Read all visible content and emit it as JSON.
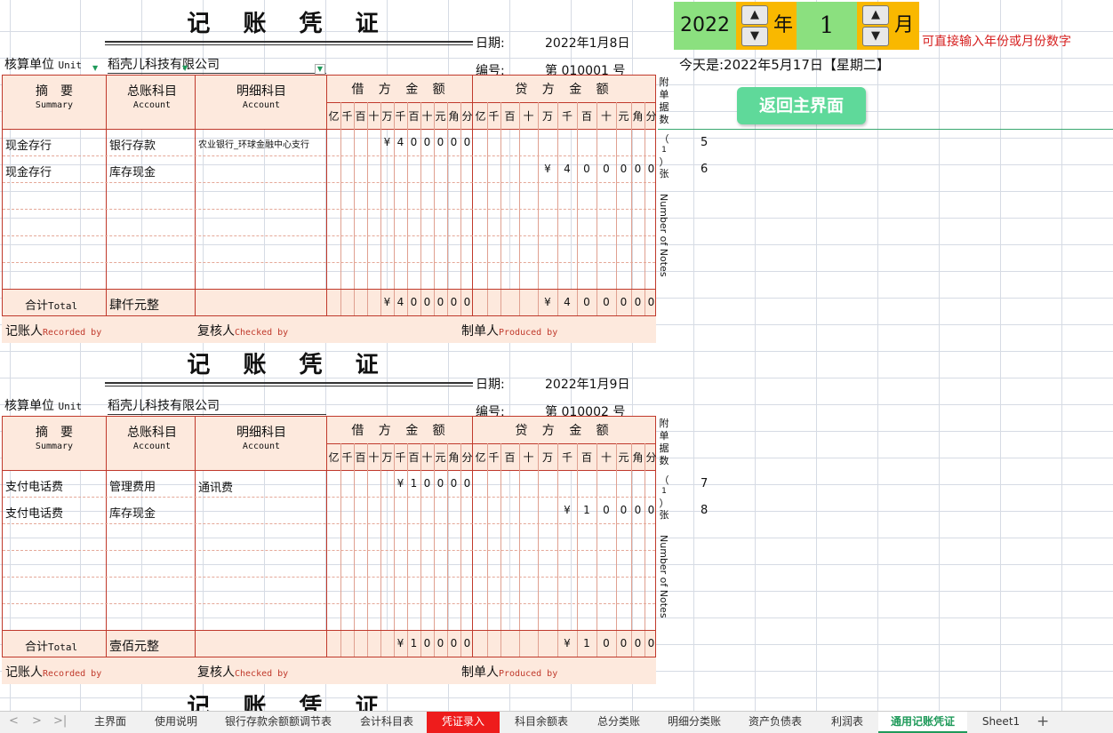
{
  "labels": {
    "title": "记 账 凭 证",
    "date": "日期:",
    "number": "编号:",
    "unit": "核算单位",
    "unit_en": "Unit",
    "summary": "摘　要",
    "summary_en": "Summary",
    "account": "总账科目",
    "account_en": "Account",
    "detail": "明细科目",
    "detail_en": "Account",
    "debit": "借 方 金 额",
    "credit": "贷 方 金 额",
    "digits_debit": [
      "亿",
      "千",
      "百",
      "十",
      "万",
      "千",
      "百",
      "十",
      "元",
      "角",
      "分"
    ],
    "digits_credit": [
      "亿",
      "千",
      "百",
      "十",
      "万",
      "千",
      "百",
      "十",
      "元",
      "角",
      "分"
    ],
    "total": "合计",
    "total_en": "Total",
    "recorder": "记账人",
    "recorder_en": "Recorded by",
    "checker": "复核人",
    "checker_en": "Checked by",
    "producer": "制单人",
    "producer_en": "Produced by",
    "attach_chars": [
      "附",
      "单",
      "据",
      "数"
    ],
    "attach_paren": [
      "（",
      "1",
      "）",
      "张"
    ],
    "notes_en": "Number of Notes"
  },
  "vouchers": [
    {
      "date": "2022年1月8日",
      "number": "第 010001 号",
      "unit_name": "稻壳儿科技有限公司",
      "rows": [
        {
          "summary": "现金存行",
          "account": "银行存款",
          "detail": "农业银行_环球金融中心支行",
          "debit": [
            "",
            "",
            "",
            "",
            "¥",
            "4",
            "0",
            "0",
            "0",
            "0",
            "0"
          ],
          "credit": [
            "",
            "",
            "",
            "",
            "",
            "",
            "",
            "",
            "",
            "",
            ""
          ]
        },
        {
          "summary": "现金存行",
          "account": "库存现金",
          "detail": "",
          "debit": [
            "",
            "",
            "",
            "",
            "",
            "",
            "",
            "",
            "",
            "",
            ""
          ],
          "credit": [
            "",
            "",
            "",
            "",
            "¥",
            "4",
            "0",
            "0",
            "0",
            "0",
            "0"
          ]
        }
      ],
      "total_text": "肆仟元整",
      "total_debit": [
        "",
        "",
        "",
        "",
        "¥",
        "4",
        "0",
        "0",
        "0",
        "0",
        "0"
      ],
      "total_credit": [
        "",
        "",
        "",
        "",
        "¥",
        "4",
        "0",
        "0",
        "0",
        "0",
        "0"
      ],
      "side_numbers": [
        "5",
        "6"
      ]
    },
    {
      "date": "2022年1月9日",
      "number": "第 010002 号",
      "unit_name": "稻壳儿科技有限公司",
      "rows": [
        {
          "summary": "支付电话费",
          "account": "管理费用",
          "detail": "通讯费",
          "debit": [
            "",
            "",
            "",
            "",
            "",
            "¥",
            "1",
            "0",
            "0",
            "0",
            "0"
          ],
          "credit": [
            "",
            "",
            "",
            "",
            "",
            "",
            "",
            "",
            "",
            "",
            ""
          ]
        },
        {
          "summary": "支付电话费",
          "account": "库存现金",
          "detail": "",
          "debit": [
            "",
            "",
            "",
            "",
            "",
            "",
            "",
            "",
            "",
            "",
            ""
          ],
          "credit": [
            "",
            "",
            "",
            "",
            "",
            "¥",
            "1",
            "0",
            "0",
            "0",
            "0"
          ]
        }
      ],
      "total_text": "壹佰元整",
      "total_debit": [
        "",
        "",
        "",
        "",
        "",
        "¥",
        "1",
        "0",
        "0",
        "0",
        "0"
      ],
      "total_credit": [
        "",
        "",
        "",
        "",
        "",
        "¥",
        "1",
        "0",
        "0",
        "0",
        "0"
      ],
      "side_numbers": [
        "7",
        "8"
      ]
    }
  ],
  "third_title_partial": "记 账 凭 证",
  "controls": {
    "year": "2022",
    "year_suffix": "年",
    "month": "1",
    "month_suffix": "月",
    "spin_up": "▲",
    "spin_down": "▼",
    "hint": "可直接输入年份或月份数字",
    "today": "今天是:2022年5月17日【星期二】",
    "back_button": "返回主界面"
  },
  "sheet_tabs": [
    "主界面",
    "使用说明",
    "银行存款余额额调节表",
    "会计科目表",
    "凭证录入",
    "科目余额表",
    "总分类账",
    "明细分类账",
    "资产负债表",
    "利润表",
    "通用记账凭证",
    "Sheet1"
  ],
  "active_tab": "通用记账凭证",
  "highlight_tab": "凭证录入",
  "tab_nav": [
    "<",
    ">",
    ">|"
  ],
  "add_sheet": "+"
}
